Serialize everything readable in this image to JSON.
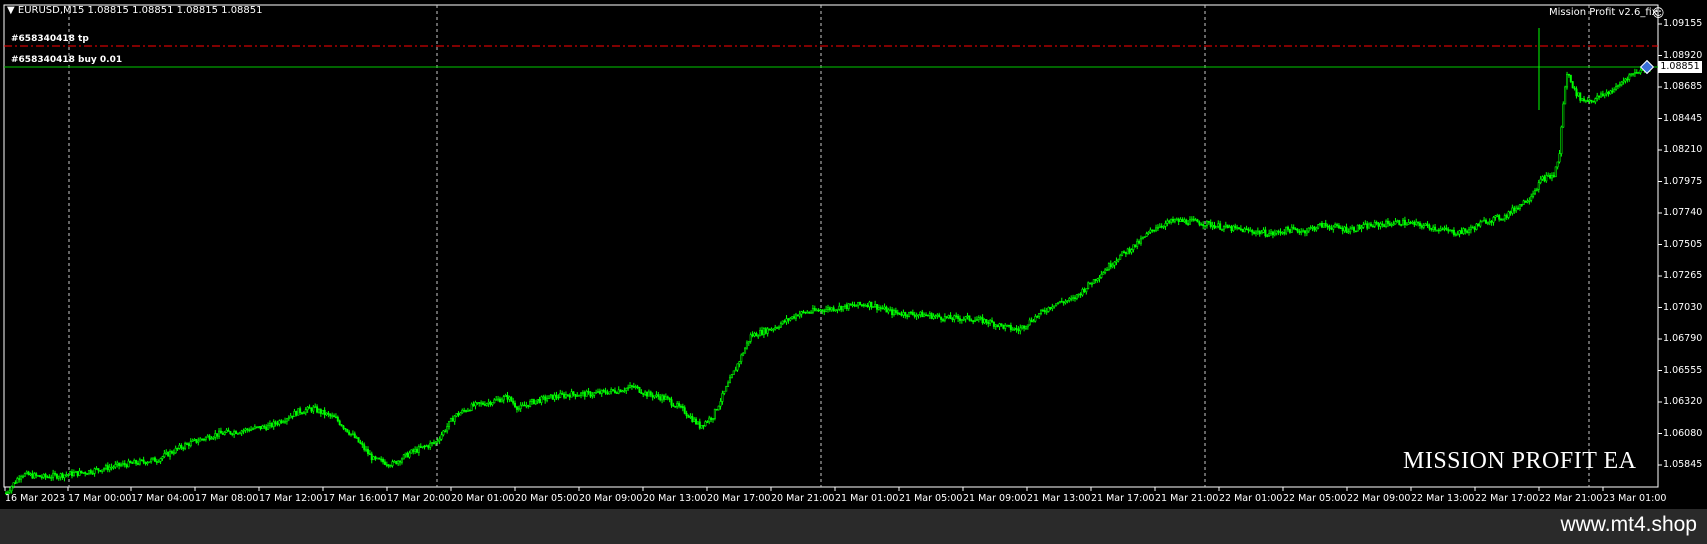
{
  "header": {
    "symbol_line": "EURUSD,M15  1.08815 1.08851 1.08815 1.08851",
    "ea_name": "Mission Profit v2.6_fix",
    "ea_icon": "smile-icon"
  },
  "orders": {
    "tp_label": "#658340418 tp",
    "buy_label": "#658340418 buy 0.01"
  },
  "bid_price": "1.08851",
  "watermark": "MISSION PROFIT EA",
  "footer": {
    "site": "www.mt4.shop"
  },
  "colors": {
    "background": "#000000",
    "candle": "#00ff00",
    "tp_line": "#ff0000",
    "order_line": "#00c800",
    "grid": "#c8c8c8",
    "footer_bg": "#2a2a2a"
  },
  "chart_data": {
    "type": "candlestick",
    "symbol": "EURUSD",
    "timeframe": "M15",
    "y_ticks": [
      "1.09155",
      "1.08920",
      "1.08685",
      "1.08445",
      "1.08210",
      "1.07975",
      "1.07740",
      "1.07505",
      "1.07265",
      "1.07030",
      "1.06790",
      "1.06555",
      "1.06320",
      "1.06080",
      "1.05845"
    ],
    "x_ticks": [
      "16 Mar 2023",
      "17 Mar 00:00",
      "17 Mar 04:00",
      "17 Mar 08:00",
      "17 Mar 12:00",
      "17 Mar 16:00",
      "17 Mar 20:00",
      "20 Mar 01:00",
      "20 Mar 05:00",
      "20 Mar 09:00",
      "20 Mar 13:00",
      "20 Mar 17:00",
      "20 Mar 21:00",
      "21 Mar 01:00",
      "21 Mar 05:00",
      "21 Mar 09:00",
      "21 Mar 13:00",
      "21 Mar 17:00",
      "21 Mar 21:00",
      "22 Mar 01:00",
      "22 Mar 05:00",
      "22 Mar 09:00",
      "22 Mar 13:00",
      "22 Mar 17:00",
      "22 Mar 21:00",
      "23 Mar 01:00"
    ],
    "ylim": [
      1.05845,
      1.09155
    ],
    "tp_price": 1.0899,
    "order_price": 1.08851,
    "close_path": [
      [
        0,
        1.0592
      ],
      [
        8,
        1.0605
      ],
      [
        20,
        1.0603
      ],
      [
        40,
        1.0606
      ],
      [
        60,
        1.0611
      ],
      [
        80,
        1.0615
      ],
      [
        95,
        1.0625
      ],
      [
        110,
        1.0632
      ],
      [
        125,
        1.0635
      ],
      [
        140,
        1.0638
      ],
      [
        155,
        1.0648
      ],
      [
        163,
        1.065
      ],
      [
        175,
        1.0643
      ],
      [
        185,
        1.063
      ],
      [
        195,
        1.0615
      ],
      [
        205,
        1.0612
      ],
      [
        215,
        1.062
      ],
      [
        228,
        1.0627
      ],
      [
        238,
        1.0645
      ],
      [
        248,
        1.0652
      ],
      [
        258,
        1.0655
      ],
      [
        266,
        1.0658
      ],
      [
        272,
        1.065
      ],
      [
        280,
        1.0655
      ],
      [
        290,
        1.0658
      ],
      [
        300,
        1.066
      ],
      [
        310,
        1.066
      ],
      [
        322,
        1.0662
      ],
      [
        333,
        1.0665
      ],
      [
        340,
        1.066
      ],
      [
        350,
        1.0657
      ],
      [
        360,
        1.0648
      ],
      [
        368,
        1.0638
      ],
      [
        375,
        1.0645
      ],
      [
        385,
        1.0672
      ],
      [
        395,
        1.07
      ],
      [
        408,
        1.0706
      ],
      [
        420,
        1.0715
      ],
      [
        433,
        1.0718
      ],
      [
        445,
        1.072
      ],
      [
        458,
        1.0722
      ],
      [
        470,
        1.0716
      ],
      [
        480,
        1.0715
      ],
      [
        490,
        1.0714
      ],
      [
        500,
        1.0712
      ],
      [
        510,
        1.0712
      ],
      [
        520,
        1.071
      ],
      [
        530,
        1.0706
      ],
      [
        537,
        1.0704
      ],
      [
        545,
        1.0712
      ],
      [
        556,
        1.0722
      ],
      [
        566,
        1.0725
      ],
      [
        576,
        1.0737
      ],
      [
        590,
        1.0754
      ],
      [
        600,
        1.0763
      ],
      [
        610,
        1.0775
      ],
      [
        620,
        1.0779
      ],
      [
        633,
        1.0778
      ],
      [
        648,
        1.0774
      ],
      [
        660,
        1.0772
      ],
      [
        672,
        1.077
      ],
      [
        680,
        1.0773
      ],
      [
        688,
        1.0772
      ],
      [
        698,
        1.0776
      ],
      [
        712,
        1.0773
      ],
      [
        725,
        1.0776
      ],
      [
        740,
        1.0778
      ],
      [
        755,
        1.0775
      ],
      [
        768,
        1.0771
      ],
      [
        775,
        1.0772
      ],
      [
        785,
        1.0779
      ],
      [
        795,
        1.0782
      ],
      [
        803,
        1.079
      ],
      [
        808,
        1.0795
      ],
      [
        815,
        1.0808
      ],
      [
        821,
        1.081
      ],
      [
        824,
        1.0825
      ],
      [
        826,
        1.086
      ],
      [
        828,
        1.088
      ],
      [
        830,
        1.0876
      ],
      [
        832,
        1.0868
      ],
      [
        836,
        1.0862
      ],
      [
        842,
        1.0862
      ],
      [
        848,
        1.0866
      ],
      [
        854,
        1.087
      ],
      [
        860,
        1.0878
      ],
      [
        866,
        1.0882
      ],
      [
        872,
        1.0885
      ]
    ],
    "close_path_x_domain": [
      0,
      872
    ]
  }
}
